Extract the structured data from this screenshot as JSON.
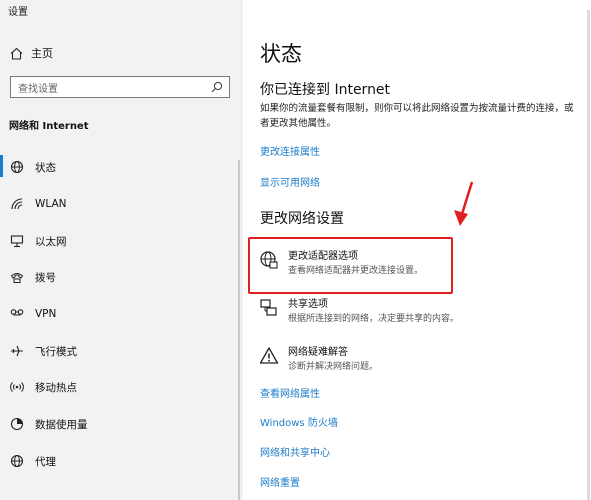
{
  "window": {
    "title": "设置"
  },
  "sidebar": {
    "home_label": "主页",
    "search_placeholder": "查找设置",
    "section_label": "网络和 Internet",
    "items": [
      {
        "label": "状态",
        "icon": "status-globe-icon",
        "active": true
      },
      {
        "label": "WLAN",
        "icon": "wifi-icon"
      },
      {
        "label": "以太网",
        "icon": "ethernet-icon"
      },
      {
        "label": "拨号",
        "icon": "dialup-icon"
      },
      {
        "label": "VPN",
        "icon": "vpn-icon"
      },
      {
        "label": "飞行模式",
        "icon": "airplane-icon"
      },
      {
        "label": "移动热点",
        "icon": "hotspot-icon"
      },
      {
        "label": "数据使用量",
        "icon": "data-usage-icon"
      },
      {
        "label": "代理",
        "icon": "proxy-globe-icon"
      }
    ]
  },
  "main": {
    "title": "状态",
    "connected_heading": "你已连接到 Internet",
    "connected_desc": "如果你的流量套餐有限制，则你可以将此网络设置为按流量计费的连接，或者更改其他属性。",
    "link_change_props": "更改连接属性",
    "link_show_networks": "显示可用网络",
    "change_heading": "更改网络设置",
    "options": [
      {
        "title": "更改适配器选项",
        "desc": "查看网络适配器并更改连接设置。",
        "icon": "adapter-icon"
      },
      {
        "title": "共享选项",
        "desc": "根据所连接到的网络，决定要共享的内容。",
        "icon": "sharing-icon"
      },
      {
        "title": "网络疑难解答",
        "desc": "诊断并解决网络问题。",
        "icon": "warning-icon"
      }
    ],
    "links_bottom": [
      "查看网络属性",
      "Windows 防火墙",
      "网络和共享中心",
      "网络重置"
    ]
  },
  "colors": {
    "accent": "#1d7cc9",
    "highlight": "#e02020",
    "sidebar_bg": "#f2f2f2"
  }
}
